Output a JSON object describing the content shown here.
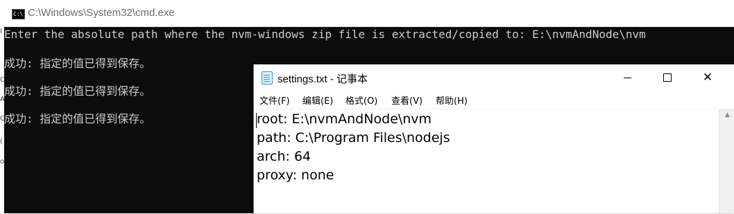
{
  "cmd": {
    "title": "C:\\Windows\\System32\\cmd.exe",
    "icon_text": "C:\\",
    "lines": [
      "Enter the absolute path where the nvm-windows zip file is extracted/copied to: E:\\nvmAndNode\\nvm",
      "成功: 指定的值已得到保存。",
      "成功: 指定的值已得到保存。",
      "成功: 指定的值已得到保存。"
    ]
  },
  "notepad": {
    "title": "settings.txt - 记事本",
    "menu": [
      "文件(F)",
      "编辑(E)",
      "格式(O)",
      "查看(V)",
      "帮助(H)"
    ],
    "lines": [
      "root: E:\\nvmAndNode\\nvm",
      "path: C:\\Program Files\\nodejs",
      "arch: 64",
      "proxy: none"
    ],
    "controls": {
      "close_glyph": "✕"
    }
  },
  "colors": {
    "console_bg": "#0c0c0c",
    "console_text": "#cccccc",
    "titlebar_bg": "#ffffff"
  }
}
